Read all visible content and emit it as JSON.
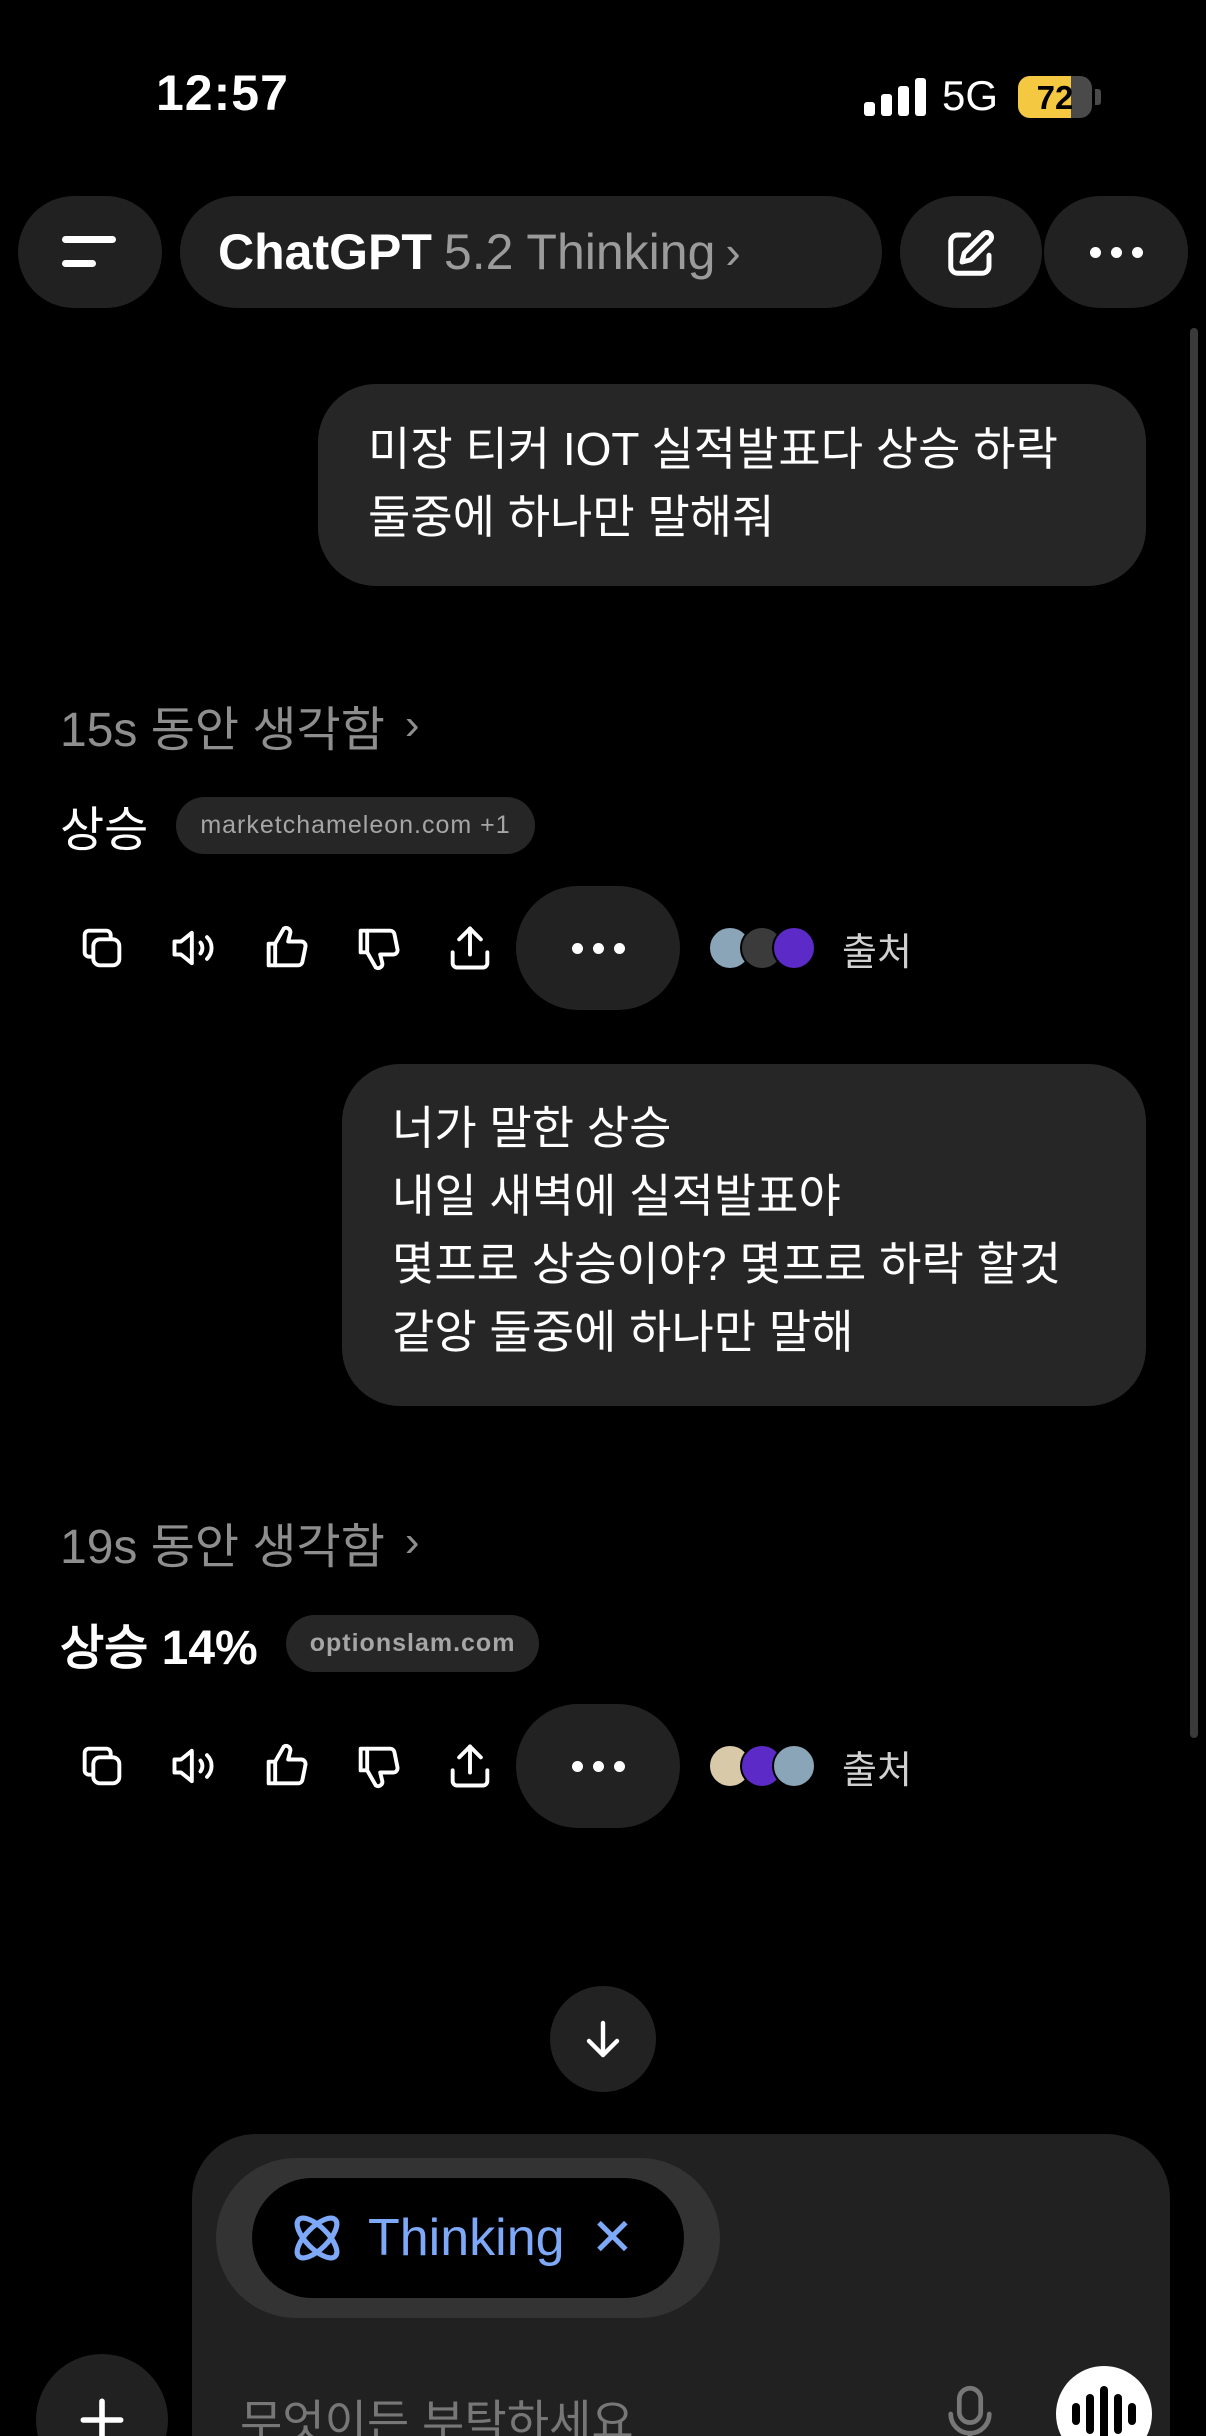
{
  "status_bar": {
    "time": "12:57",
    "network": "5G",
    "battery": "72",
    "battery_level": 0.72
  },
  "header": {
    "app_name": "ChatGPT",
    "model": "5.2 Thinking",
    "chevron": "›"
  },
  "messages": [
    {
      "role": "user",
      "lines": [
        "미장 티커 IOT 실적발표다 상승 하락",
        "둘중에 하나만 말해줘"
      ]
    },
    {
      "role": "assistant",
      "thought": "15s 동안 생각함",
      "answer": "상승",
      "source_chip": "marketchameleon.com +1",
      "sources_label": "출처"
    },
    {
      "role": "user",
      "lines": [
        "너가 말한 상승",
        "내일 새벽에 실적발표야",
        "몇프로 상승이야? 몇프로 하락 할것",
        "같앙 둘중에 하나만 말해"
      ]
    },
    {
      "role": "assistant",
      "thought": "19s 동안 생각함",
      "answer": "상승 14%",
      "source_chip": "optionslam.com",
      "sources_label": "출처"
    }
  ],
  "composer": {
    "mode_label": "Thinking",
    "mode_close": "✕",
    "placeholder": "무엇이든 부탁하세요"
  },
  "colors": {
    "background": "#000000",
    "surface": "#212121",
    "bubble": "#262626",
    "accent_blue": "#7ea8f8",
    "battery": "#f5c842"
  }
}
